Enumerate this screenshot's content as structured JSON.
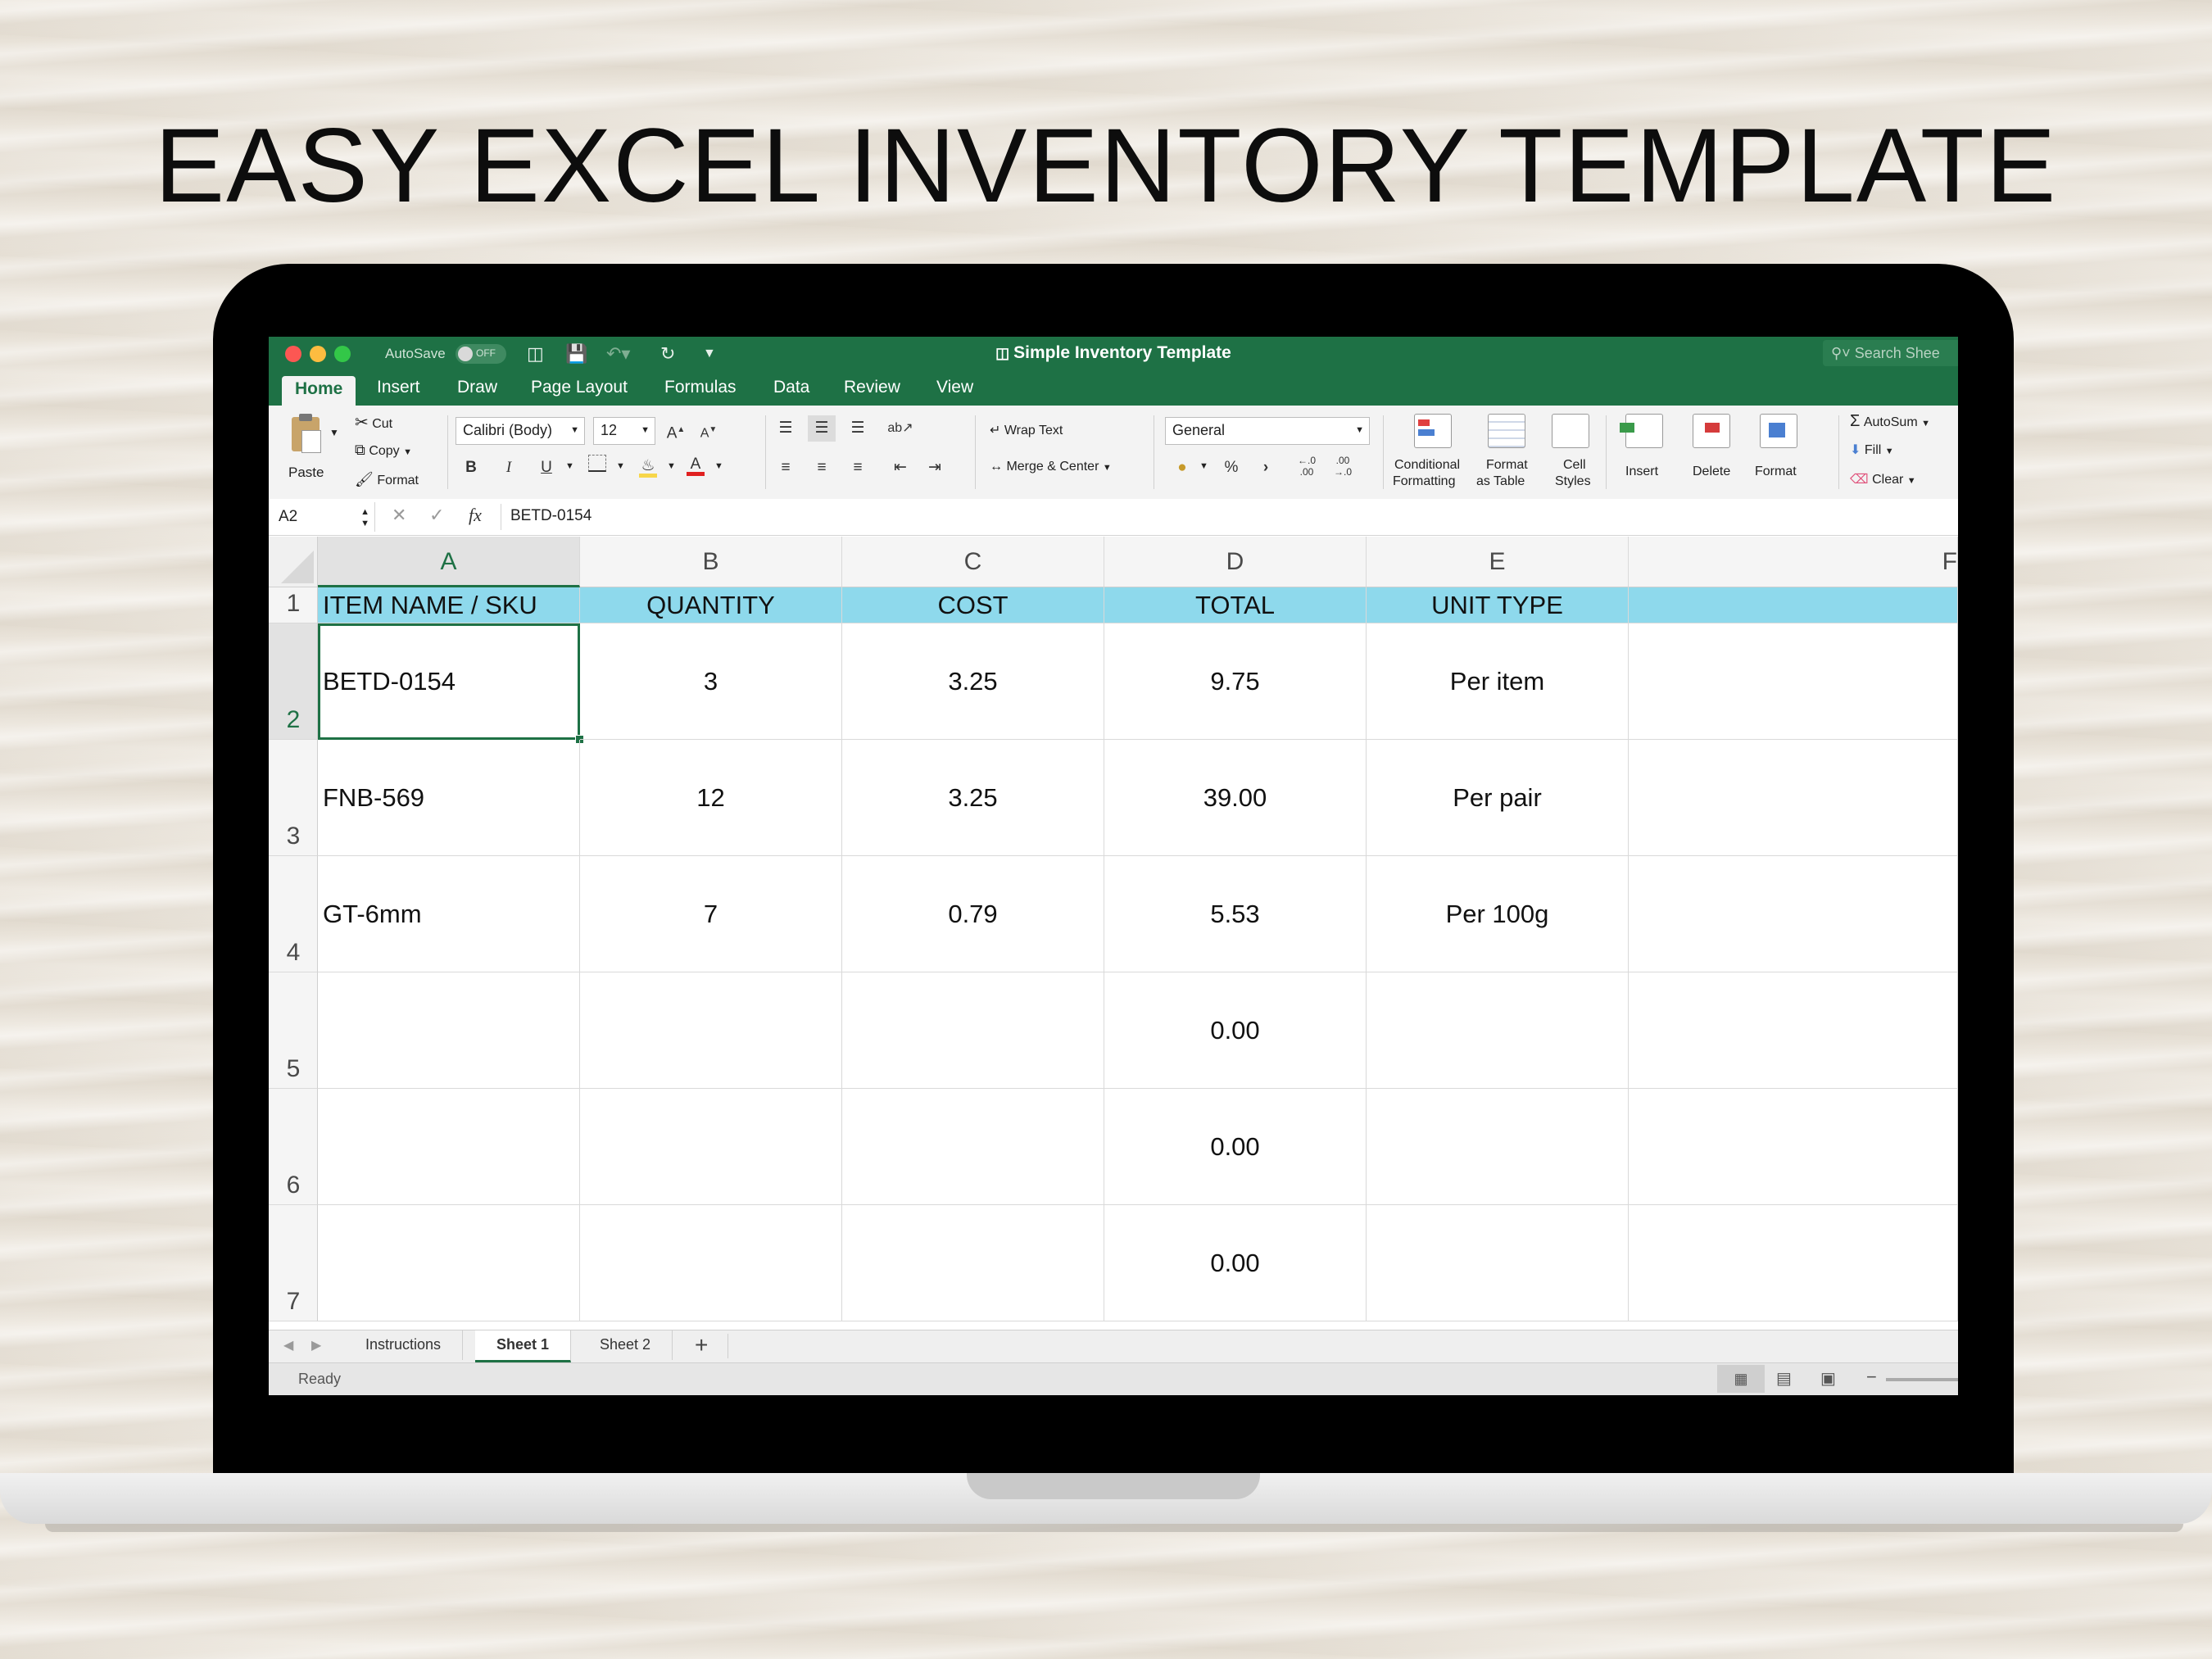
{
  "headline": "EASY EXCEL INVENTORY TEMPLATE",
  "window": {
    "title": "Simple Inventory Template",
    "autosave_label": "AutoSave",
    "autosave_state": "OFF",
    "search_placeholder": "Search Shee"
  },
  "tabs": [
    "Home",
    "Insert",
    "Draw",
    "Page Layout",
    "Formulas",
    "Data",
    "Review",
    "View"
  ],
  "ribbon": {
    "paste": "Paste",
    "cut": "Cut",
    "copy": "Copy",
    "format_painter": "Format",
    "font_name": "Calibri (Body)",
    "font_size": "12",
    "wrap_text": "Wrap Text",
    "merge_center": "Merge & Center",
    "number_format": "General",
    "conditional_formatting_1": "Conditional",
    "conditional_formatting_2": "Formatting",
    "format_as_table_1": "Format",
    "format_as_table_2": "as Table",
    "cell_styles_1": "Cell",
    "cell_styles_2": "Styles",
    "insert": "Insert",
    "delete": "Delete",
    "format": "Format",
    "autosum": "AutoSum",
    "fill": "Fill",
    "clear": "Clear"
  },
  "formula_bar": {
    "name_box": "A2",
    "content": "BETD-0154"
  },
  "columns": [
    "A",
    "B",
    "C",
    "D",
    "E",
    "F"
  ],
  "rows": [
    "1",
    "2",
    "3",
    "4",
    "5",
    "6",
    "7"
  ],
  "header_row": [
    "ITEM NAME / SKU",
    "QUANTITY",
    "COST",
    "TOTAL",
    "UNIT TYPE"
  ],
  "data_rows": [
    [
      "BETD-0154",
      "3",
      "3.25",
      "9.75",
      "Per item"
    ],
    [
      "FNB-569",
      "12",
      "3.25",
      "39.00",
      "Per pair"
    ],
    [
      "GT-6mm",
      "7",
      "0.79",
      "5.53",
      "Per 100g"
    ],
    [
      "",
      "",
      "",
      "0.00",
      ""
    ],
    [
      "",
      "",
      "",
      "0.00",
      ""
    ],
    [
      "",
      "",
      "",
      "0.00",
      ""
    ]
  ],
  "sheet_tabs": [
    "Instructions",
    "Sheet 1",
    "Sheet 2"
  ],
  "active_sheet": "Sheet 1",
  "status": "Ready",
  "colors": {
    "excel_green": "#1e7145",
    "header_fill": "#8ed9ec"
  }
}
